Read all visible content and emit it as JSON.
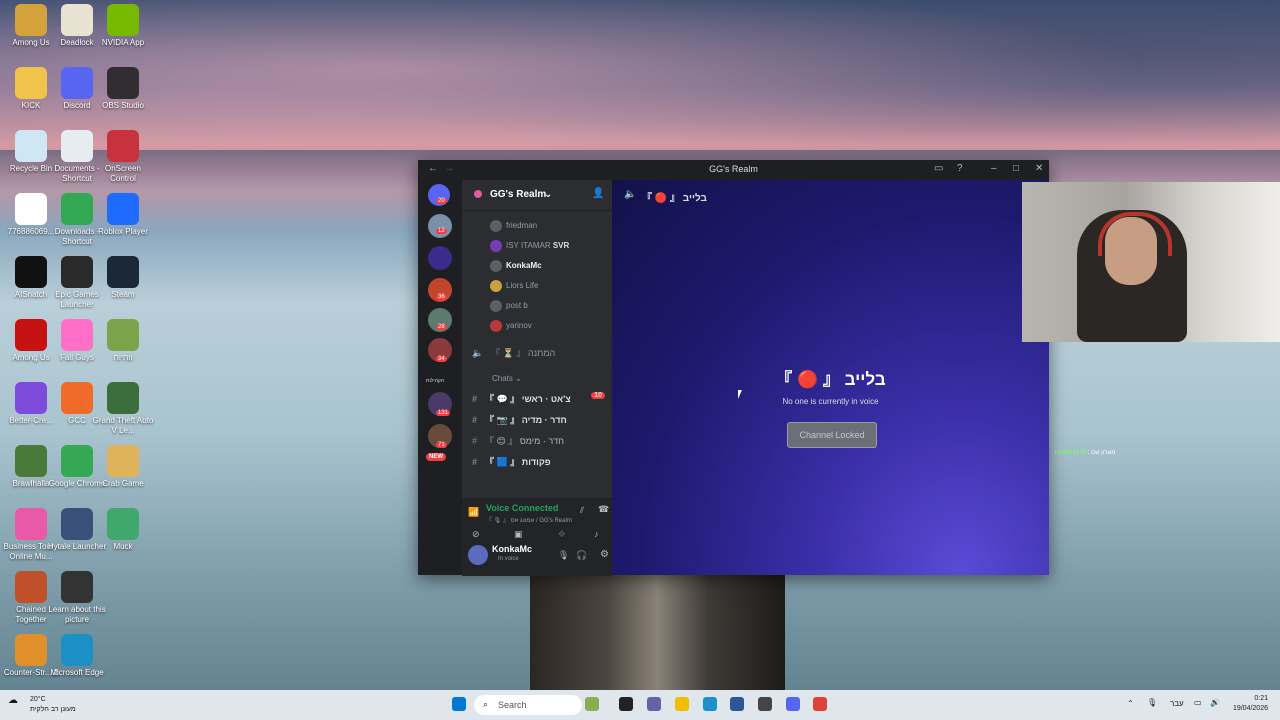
{
  "desktop": {
    "icons": [
      {
        "label": "Among Us",
        "color": "#d4a23b"
      },
      {
        "label": "Deadlock",
        "color": "#e8e2d2"
      },
      {
        "label": "NVIDIA App",
        "color": "#76b900"
      },
      {
        "label": "KICK",
        "color": "#f0c34a"
      },
      {
        "label": "Discord",
        "color": "#5865f2"
      },
      {
        "label": "OBS Studio",
        "color": "#302e31"
      },
      {
        "label": "Recycle Bin",
        "color": "#cfe6f5"
      },
      {
        "label": "Documents - Shortcut",
        "color": "#e7ecf2"
      },
      {
        "label": "OnScreen Control",
        "color": "#c8323c"
      },
      {
        "label": "776886069...",
        "color": "#ffffff"
      },
      {
        "label": "Downloads - Shortcut",
        "color": "#32a852"
      },
      {
        "label": "Roblox Player",
        "color": "#1e6bff"
      },
      {
        "label": "AISnatch",
        "color": "#111111"
      },
      {
        "label": "Epic Games Launcher",
        "color": "#2a2a2a"
      },
      {
        "label": "Steam",
        "color": "#1b2838"
      },
      {
        "label": "Among Us",
        "color": "#c51111"
      },
      {
        "label": "Fall Guys",
        "color": "#ff6ec7"
      },
      {
        "label": "ווחיוח",
        "color": "#7aa34a"
      },
      {
        "label": "Better-Cre...",
        "color": "#7d4cdb"
      },
      {
        "label": "GCC",
        "color": "#f06a2a"
      },
      {
        "label": "Grand Theft Auto V Le...",
        "color": "#3c6e3c"
      },
      {
        "label": "Brawlhalla",
        "color": "#4a7a3a"
      },
      {
        "label": "Google Chrome",
        "color": "#34a853"
      },
      {
        "label": "Crab Game",
        "color": "#e0b25a"
      },
      {
        "label": "Business Tour - Online Mu...",
        "color": "#e85aa8"
      },
      {
        "label": "Hytale Launcher",
        "color": "#3a4f7a"
      },
      {
        "label": "Muck",
        "color": "#3fa86a"
      },
      {
        "label": "Chained Together",
        "color": "#c0502a"
      },
      {
        "label": "Learn about this picture",
        "color": "#333333"
      },
      {
        "label": "Counter-Str... 2",
        "color": "#e0902a"
      },
      {
        "label": "Microsoft Edge",
        "color": "#1e90c8"
      }
    ]
  },
  "window": {
    "title": "GG's Realm",
    "server_name": "GG's Realm",
    "server_badges": [
      "20",
      "12",
      "36",
      "28",
      "34",
      "131",
      "71"
    ],
    "new_badge": "NEW",
    "side_label": "הקהילות",
    "members": [
      {
        "name": "friedman"
      },
      {
        "name": "ISY ITAMAR",
        "tag": "SVR"
      },
      {
        "name": "KonkaMc"
      },
      {
        "name": "Liors Life"
      },
      {
        "name": "post b"
      },
      {
        "name": "yarinov"
      }
    ],
    "voice_room": "『 ⏳ 』 המתנה",
    "category": "Chats",
    "channels": [
      {
        "name": "『 💬 』 צ'אט · ראשי",
        "badge": "10"
      },
      {
        "name": "『 📷 』 חדר · מדיה"
      },
      {
        "name": "『 😊 』 חדר · מימס"
      },
      {
        "name": "『 🟦 』 פקודות"
      }
    ],
    "voice_status": "Voice Connected",
    "voice_sub": "『 🎙 』 אמונג אס / GG's Realm",
    "username": "KonkaMc",
    "user_status": "In voice",
    "channel_header": "『 🔴 』 בלייב",
    "center_title": "『 🔴 』 בלייב",
    "center_sub": "No one is currently in voice",
    "locked_label": "Channel Locked"
  },
  "stream_chat": {
    "nick": "multifire123",
    "text": ": מארון שם"
  },
  "taskbar": {
    "weather_temp": "20°C",
    "weather_desc": "מעונן רב חלקית",
    "search_placeholder": "Search",
    "lang": "עבר",
    "time": "0:21",
    "date": "19/04/2026"
  }
}
